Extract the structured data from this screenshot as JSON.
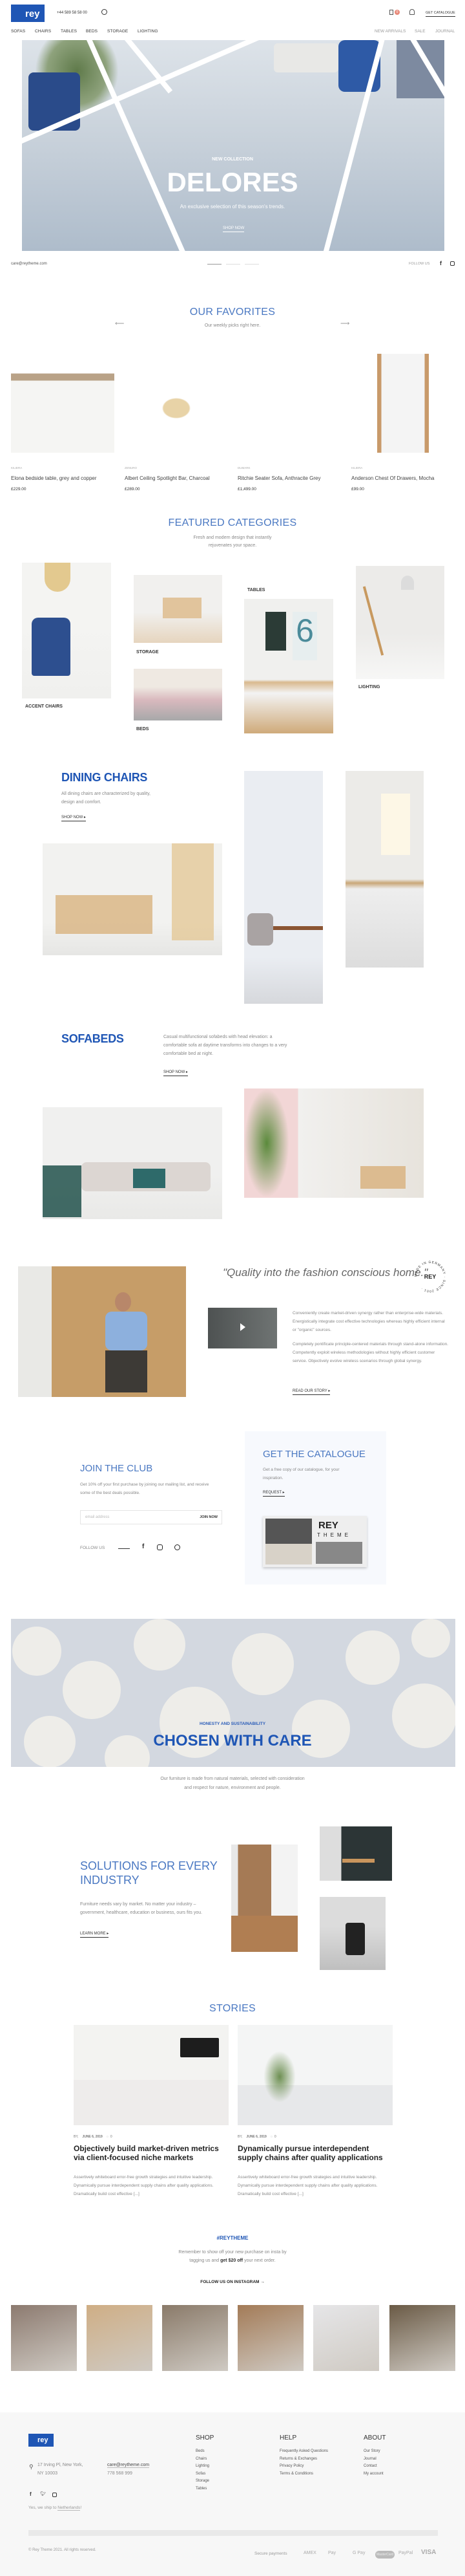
{
  "colors": {
    "brand": "#1f56b5",
    "accent": "#4a78c2",
    "cart_badge": "#e88a7a",
    "footer_bg": "#f7f7f7"
  },
  "header": {
    "logo": "rey",
    "phone": "+44 589 58 58 00",
    "search_icon": "search-icon",
    "cart_icon": "cart-icon",
    "cart_count": "0",
    "account_icon": "user-icon",
    "get_catalogue": "GET CATALOGUE",
    "nav": [
      "SOFAS",
      "CHAIRS",
      "TABLES",
      "BEDS",
      "STORAGE",
      "LIGHTING"
    ],
    "nav_right": [
      "NEW ARRIVALS",
      "SALE",
      "JOURNAL"
    ]
  },
  "hero": {
    "eyebrow": "NEW COLLECTION",
    "title": "DELORES",
    "subtitle": "An exclusive selection of this season's trends.",
    "cta": "SHOP NOW",
    "email": "care@reytheme.com",
    "follow": "FOLLOW US",
    "slides": 3
  },
  "favorites": {
    "title": "OUR FAVORITES",
    "subtitle": "Our weekly picks right here.",
    "products": [
      {
        "brand": "KILIERA",
        "name": "Elona bedside table, grey and copper",
        "price": "£229.00"
      },
      {
        "brand": "ZENURO",
        "name": "Albert Ceiling Spotlight Bar, Charcoal",
        "price": "£289.00"
      },
      {
        "brand": "DUMARK",
        "name": "Ritchie Seater Sofa, Anthracite Grey",
        "price": "£1,499.00"
      },
      {
        "brand": "KILIERA",
        "name": "Anderson Chest Of Drawers, Mocha",
        "price": "£99.00"
      }
    ]
  },
  "categories": {
    "title": "FEATURED CATEGORIES",
    "subtitle1": "Fresh and modern design that instantly",
    "subtitle2": "rejuvenates your space.",
    "items": [
      "ACCENT CHAIRS",
      "STORAGE",
      "BEDS",
      "TABLES",
      "LIGHTING"
    ]
  },
  "dining": {
    "title": "DINING CHAIRS",
    "text1": "All dining chairs are characterized by quality,",
    "text2": "design and comfort.",
    "cta": "SHOP NOW"
  },
  "sofabeds": {
    "title": "SOFABEDS",
    "text1": "Casual multifunctional sofabeds with head elevation: a",
    "text2": "comfortable sofa at daytime transforms into changes to a very",
    "text3": "comfortable bed at night.",
    "cta": "SHOP NOW"
  },
  "story": {
    "quote": "\"Quality into the fashion conscious home.\"",
    "badge": "REY",
    "badge_ring": "MADE IN GERMANY · SINCE 2001 ·",
    "p1": "Conveniently create market-driven synergy rather than enterprise-wide materials. Energistically integrate cost effective technologies whereas highly efficient internal or \"organic\" sources.",
    "p2": "Completely pontificate principle-centered materials through stand-alone information. Competently exploit wireless methodologies without highly efficient customer service. Objectively evolve wireless scenarios through global synergy.",
    "cta": "READ OUR STORY"
  },
  "club": {
    "title": "JOIN THE CLUB",
    "text": "Get 10% off your first purchase by joining our mailing list, and receive some of the best deals possible.",
    "placeholder": "email address",
    "button": "JOIN NOW",
    "follow": "FOLLOW US"
  },
  "catalogue": {
    "title": "GET THE CATALOGUE",
    "text": "Get a free copy of our catalogue, for your inspiration.",
    "cta": "REQUEST",
    "book_title": "REY",
    "book_sub": "THEME"
  },
  "care": {
    "eyebrow": "HONESTY AND SUSTAINABILITY",
    "title": "CHOSEN WITH CARE",
    "text1": "Our furniture is made from natural materials, selected with consideration",
    "text2": "and respect for nature, environment and people."
  },
  "solutions": {
    "title1": "SOLUTIONS FOR EVERY",
    "title2": "INDUSTRY",
    "text1": "Furniture needs vary by market. No matter your industry –",
    "text2": "government, healthcare, education or business, ours fits you.",
    "cta": "LEARN MORE"
  },
  "stories": {
    "title": "STORIES",
    "posts": [
      {
        "by": "BY,",
        "date": "JUNE 6, 2019",
        "comments": "0",
        "title": "Objectively build market-driven metrics via client-focused niche markets",
        "excerpt": "Assertively whiteboard error-free growth strategies and intuitive leadership. Dynamically pursue interdependent supply chains after quality applications. Dramatically build cost effective [...]"
      },
      {
        "by": "BY,",
        "date": "JUNE 6, 2019",
        "comments": "0",
        "title": "Dynamically pursue interdependent supply chains after quality applications",
        "excerpt": "Assertively whiteboard error-free growth strategies and intuitive leadership. Dynamically pursue interdependent supply chains after quality applications. Dramatically build cost effective [...]"
      }
    ]
  },
  "instagram": {
    "tag": "#REYTHEME",
    "text1": "Remember to show off your new purchase on insta by",
    "text2a": "tagging us and ",
    "text2b": "get $20 off",
    "text2c": " your next order.",
    "cta": "FOLLOW US ON INSTAGRAM"
  },
  "footer": {
    "logo": "rey",
    "address1": "17 Irving Pl, New York,",
    "address2": "NY 10003",
    "email": "care@reytheme.com",
    "phone": "778 568 999",
    "ship_a": "Yes, we ship to ",
    "ship_b": "Netherlands",
    "ship_c": "!",
    "shop_title": "SHOP",
    "shop": [
      "Beds",
      "Chairs",
      "Lighting",
      "Sofas",
      "Storage",
      "Tables"
    ],
    "help_title": "HELP",
    "help": [
      "Frequently Asked Questions",
      "Returns & Exchanges",
      "Privacy Policy",
      "Terms & Conditions"
    ],
    "about_title": "ABOUT",
    "about": [
      "Our Story",
      "Journal",
      "Contact",
      "My account"
    ],
    "copyright": "© Rey Theme 2021. All rights reserved.",
    "secure": "Secure payments",
    "payments": [
      "AMEX",
      "Pay",
      "G Pay",
      "MasterCard",
      "PayPal",
      "VISA"
    ]
  }
}
